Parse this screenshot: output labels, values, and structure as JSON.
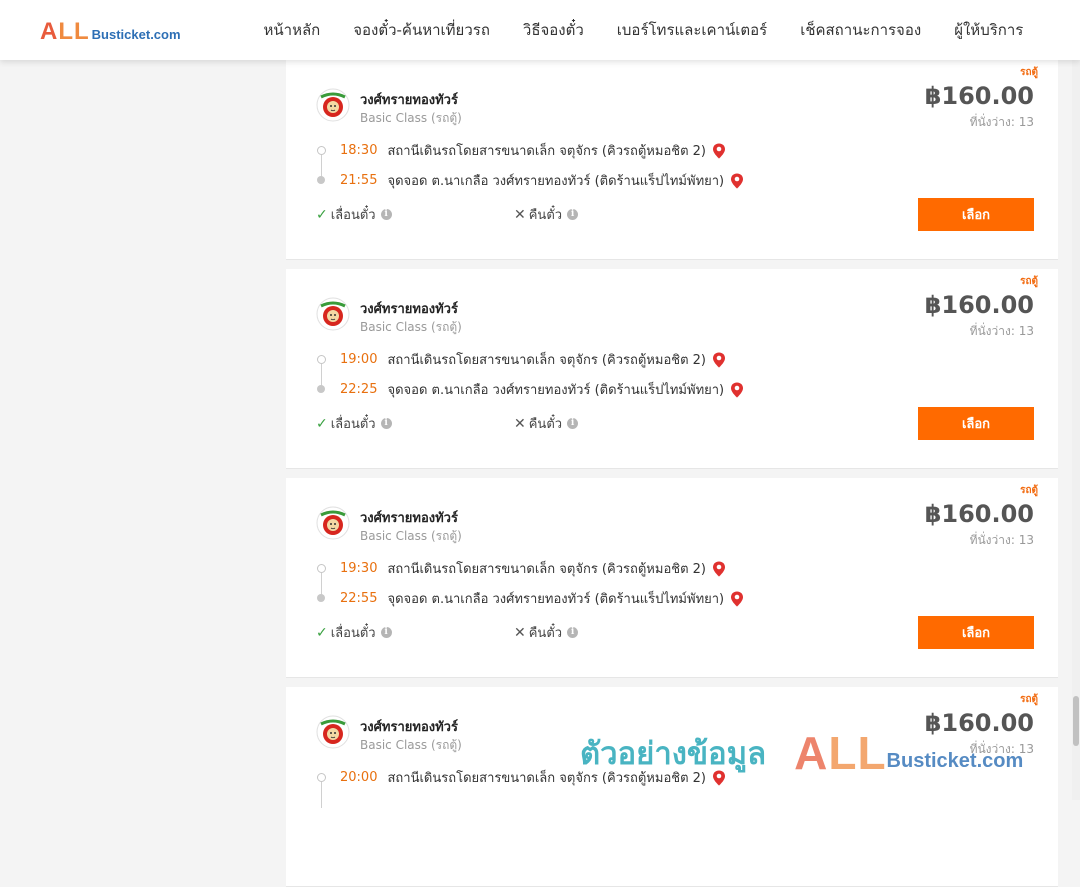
{
  "brand": {
    "logo_all_a": "A",
    "logo_all_rest": "LL",
    "logo_site": "Busticket.com"
  },
  "nav": [
    {
      "label": "หน้าหลัก"
    },
    {
      "label": "จองตั๋ว-ค้นหาเที่ยวรถ"
    },
    {
      "label": "วิธีจองตั๋ว"
    },
    {
      "label": "เบอร์โทรและเคาน์เตอร์"
    },
    {
      "label": "เช็คสถานะการจอง"
    },
    {
      "label": "ผู้ให้บริการ"
    }
  ],
  "trips": [
    {
      "tag": "รถตู้",
      "operator": "วงศ์ทรายทองทัวร์",
      "class": "Basic Class (รถตู้)",
      "price": "฿160.00",
      "seats": "ที่นั่งว่าง: 13",
      "dep_time": "18:30",
      "dep_place": "สถานีเดินรถโดยสารขนาดเล็ก จตุจักร (คิวรถตู้หมอชิต 2)",
      "arr_time": "21:55",
      "arr_place": "จุดจอด ต.นาเกลือ วงศ์ทรายทองทัวร์ (ติดร้านแร็ปไทม์พัทยา)",
      "policy_change": "เลื่อนตั๋ว",
      "policy_refund": "คืนตั๋ว",
      "button": "เลือก"
    },
    {
      "tag": "รถตู้",
      "operator": "วงศ์ทรายทองทัวร์",
      "class": "Basic Class (รถตู้)",
      "price": "฿160.00",
      "seats": "ที่นั่งว่าง: 13",
      "dep_time": "19:00",
      "dep_place": "สถานีเดินรถโดยสารขนาดเล็ก จตุจักร (คิวรถตู้หมอชิต 2)",
      "arr_time": "22:25",
      "arr_place": "จุดจอด ต.นาเกลือ วงศ์ทรายทองทัวร์ (ติดร้านแร็ปไทม์พัทยา)",
      "policy_change": "เลื่อนตั๋ว",
      "policy_refund": "คืนตั๋ว",
      "button": "เลือก"
    },
    {
      "tag": "รถตู้",
      "operator": "วงศ์ทรายทองทัวร์",
      "class": "Basic Class (รถตู้)",
      "price": "฿160.00",
      "seats": "ที่นั่งว่าง: 13",
      "dep_time": "19:30",
      "dep_place": "สถานีเดินรถโดยสารขนาดเล็ก จตุจักร (คิวรถตู้หมอชิต 2)",
      "arr_time": "22:55",
      "arr_place": "จุดจอด ต.นาเกลือ วงศ์ทรายทองทัวร์ (ติดร้านแร็ปไทม์พัทยา)",
      "policy_change": "เลื่อนตั๋ว",
      "policy_refund": "คืนตั๋ว",
      "button": "เลือก"
    },
    {
      "tag": "รถตู้",
      "operator": "วงศ์ทรายทองทัวร์",
      "class": "Basic Class (รถตู้)",
      "price": "฿160.00",
      "seats": "ที่นั่งว่าง: 13",
      "dep_time": "20:00",
      "dep_place": "สถานีเดินรถโดยสารขนาดเล็ก จตุจักร (คิวรถตู้หมอชิต 2)",
      "arr_time": "",
      "arr_place": "",
      "policy_change": "",
      "policy_refund": "",
      "button": ""
    }
  ],
  "watermark": {
    "thai": "ตัวอย่างข้อมูล",
    "all_a": "A",
    "all_rest": "LL",
    "site": "Busticket.com"
  },
  "colors": {
    "accent": "#ff6a00",
    "time": "#e8700f",
    "check": "#3aa141",
    "pin": "#e0312f"
  },
  "icons": {
    "operator_logo": "lion-logo-icon",
    "location": "map-pin-icon",
    "change": "check-icon",
    "refund": "cross-icon",
    "info": "info-icon"
  }
}
